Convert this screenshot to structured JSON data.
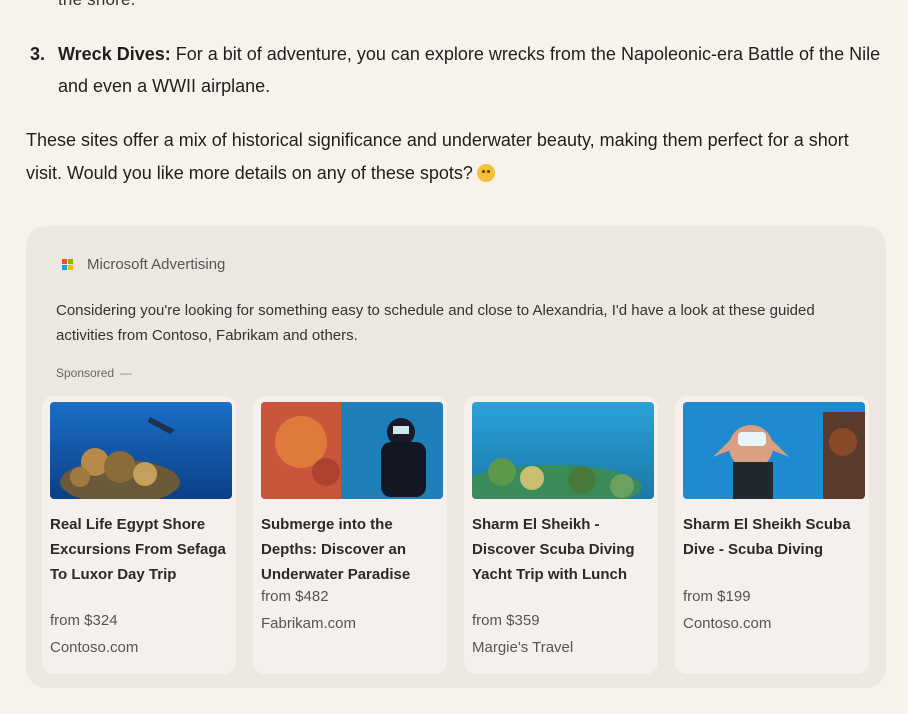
{
  "chat": {
    "cut_text": "the shore.",
    "item3": {
      "number": "3.",
      "term": "Wreck Dives:",
      "text": " For a bit of adventure, you can explore wrecks from the Napoleonic-era Battle of the Nile and even a WWII airplane."
    },
    "paragraph": "These sites offer a mix of historical significance and underwater beauty, making them perfect for a short visit. Would you like more details on any of these spots?"
  },
  "ad": {
    "brand": "Microsoft Advertising",
    "logo_colors": [
      "#f25022",
      "#7fba00",
      "#00a4ef",
      "#ffb900"
    ],
    "description": "Considering you're looking for something easy to schedule and close to Alexandria, I'd have a look at these guided activities from Contoso, Fabrikam and others.",
    "sponsored_label": "Sponsored",
    "sponsored_dash": "—",
    "cards": [
      {
        "title": "Real Life Egypt Shore Excursions From Sefaga To Luxor Day Trip",
        "price": "from $324",
        "site": "Contoso.com",
        "image": "coral-reef-diver"
      },
      {
        "title": "Submerge into the Depths: Discover an Underwater Paradise",
        "price": "from $482",
        "site": "Fabrikam.com",
        "image": "scuba-diver-orange-coral"
      },
      {
        "title": "Sharm El Sheikh - Discover Scuba Diving Yacht Trip with Lunch",
        "price": "from $359",
        "site": "Margie's Travel",
        "image": "reef-underwater"
      },
      {
        "title": "Sharm El Sheikh Scuba Dive - Scuba Diving",
        "price": "from $199",
        "site": "Contoso.com",
        "image": "diver-making-heart"
      }
    ]
  }
}
